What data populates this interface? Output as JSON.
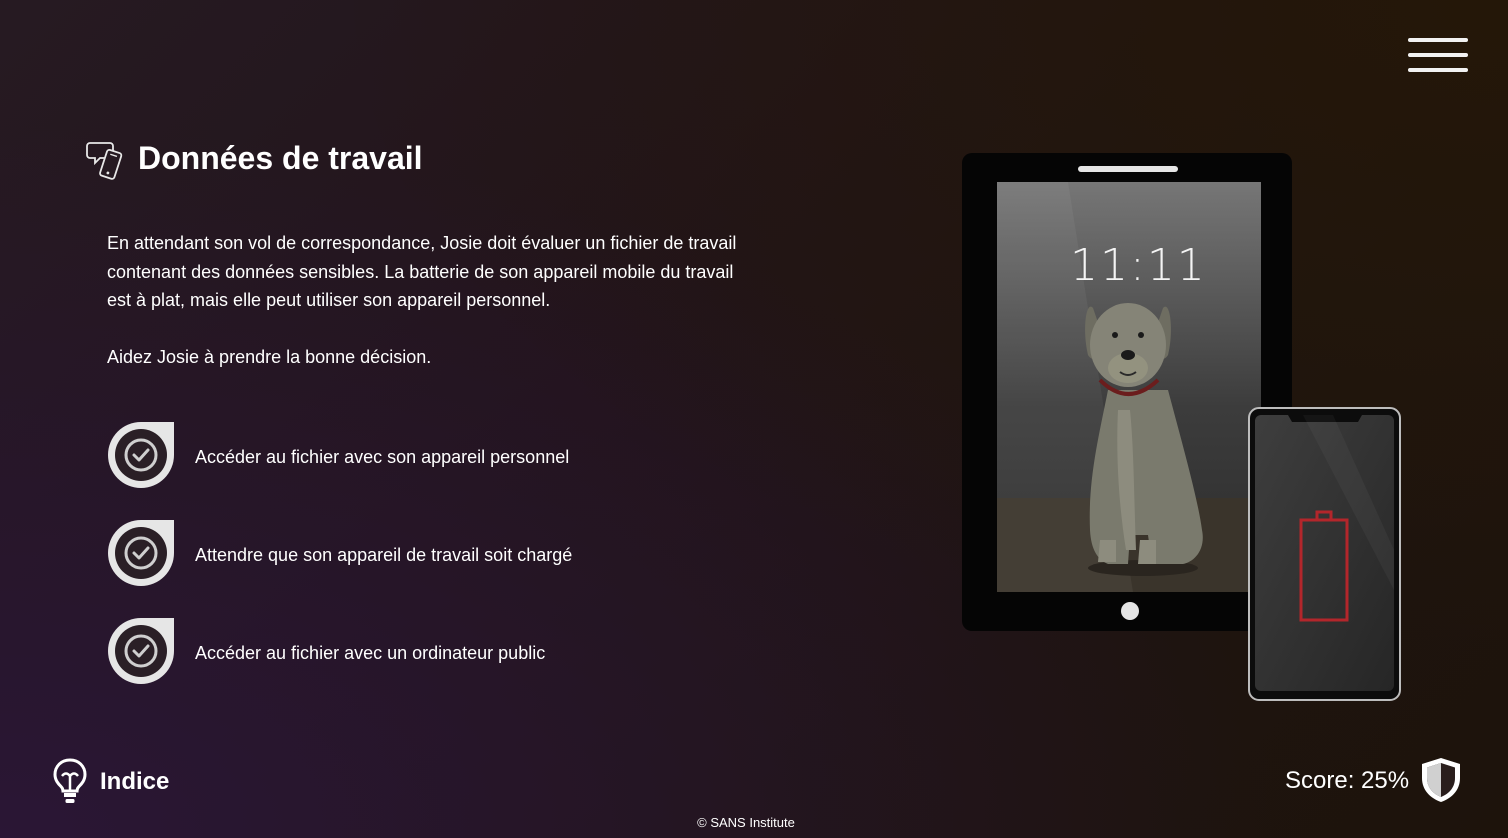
{
  "header": {
    "menu_icon": "hamburger-menu-icon"
  },
  "page": {
    "title": "Données de travail",
    "title_icon": "chat-phone-icon",
    "paragraphs": [
      "En attendant son vol de correspondance, Josie doit évaluer un fichier de travail contenant des données sensibles. La batterie de son appareil mobile du travail est à plat, mais elle peut utiliser son appareil personnel.",
      "Aidez Josie à prendre la bonne décision."
    ]
  },
  "options": [
    {
      "label": "Accéder au fichier avec son appareil personnel",
      "icon": "check-circle-icon"
    },
    {
      "label": "Attendre que son appareil de travail soit chargé",
      "icon": "check-circle-icon"
    },
    {
      "label": "Accéder au fichier avec un ordinateur public",
      "icon": "check-circle-icon"
    }
  ],
  "illustration": {
    "tablet_clock": "11:11",
    "phone_status": "battery-empty-icon",
    "colors": {
      "battery_empty": "#b3262b",
      "tablet_frame": "#050505",
      "phone_frame": "#bcbcbc"
    }
  },
  "footer": {
    "hint_label": "Indice",
    "hint_icon": "lightbulb-icon",
    "score_text": "Score: 25%",
    "score_value_percent": 25,
    "shield_icon": "shield-icon",
    "copyright": "© SANS Institute"
  }
}
